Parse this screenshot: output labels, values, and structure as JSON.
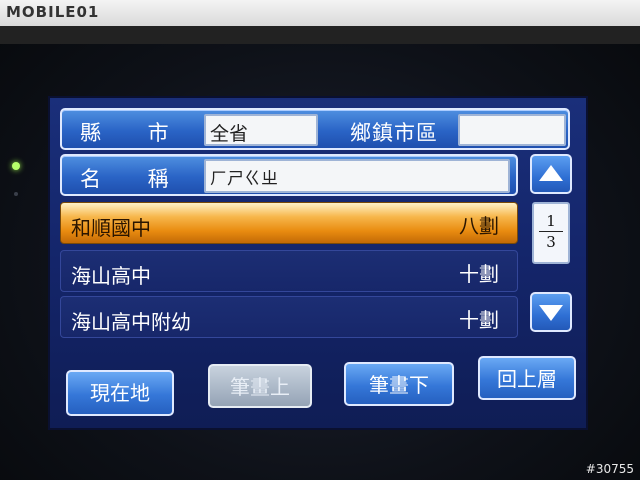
{
  "watermark": "MOBILE01",
  "photo_id": "#30755",
  "search": {
    "county_label": "縣  市",
    "county_value": "全省",
    "township_label": "鄉鎮市區",
    "township_value": "",
    "name_label": "名  稱",
    "name_value": "ㄏㄕㄍㄓ"
  },
  "results": {
    "items": [
      {
        "name": "和順國中",
        "strokes": "八劃",
        "selected": true
      },
      {
        "name": "海山高中",
        "strokes": "十劃",
        "selected": false
      },
      {
        "name": "海山高中附幼",
        "strokes": "十劃",
        "selected": false
      }
    ]
  },
  "pager": {
    "current": "1",
    "total": "3"
  },
  "buttons": {
    "current_location": "現在地",
    "stroke_up": "筆畫上",
    "stroke_down": "筆畫下",
    "back": "回上層"
  },
  "colors": {
    "selected_row": "#e98b10",
    "button_blue": "#3577d8",
    "screen_bg": "#14256a",
    "disabled_button": "#a9b6c6"
  }
}
